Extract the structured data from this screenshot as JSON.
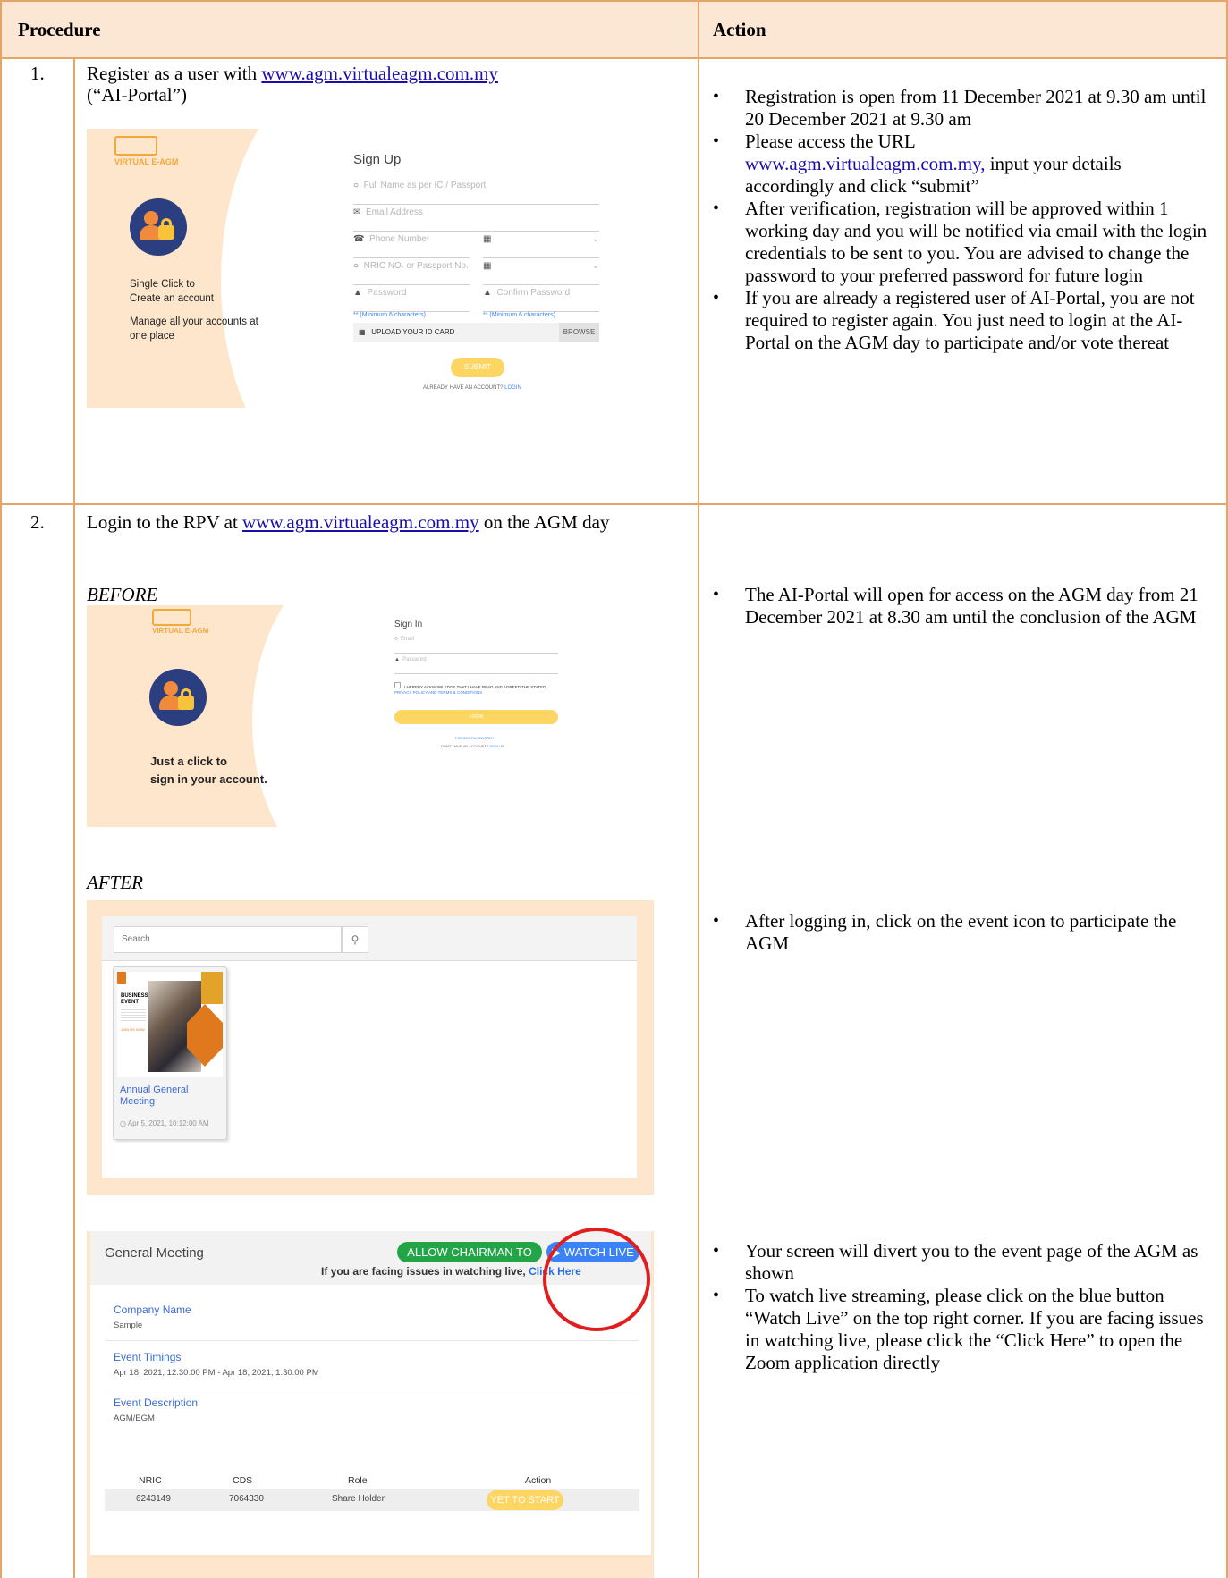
{
  "header": {
    "procedure": "Procedure",
    "action": "Action"
  },
  "rows": [
    {
      "number": "1.",
      "procedure_text_1": "Register as a user with ",
      "procedure_link": "www.agm.virtualeagm.com.my",
      "procedure_text_2": "(“AI-Portal”)",
      "signup": {
        "brand": "VIRTUAL E-AGM",
        "tagline_1": "Single Click to",
        "tagline_2": "Create an account",
        "tagline_3": "Manage all your accounts at",
        "tagline_4": "one place",
        "title": "Sign Up",
        "fullname_placeholder": "Full Name as per IC / Passport",
        "email_placeholder": "Email Address",
        "phone_placeholder": "Phone Number",
        "nric_placeholder": "NRIC NO. or Passport No.",
        "password_placeholder": "Password",
        "confirm_placeholder": "Confirm Password",
        "min_note": "** (Minimum 6 characters)",
        "upload_label": "UPLOAD YOUR ID CARD",
        "browse_label": "BROWSE",
        "submit_label": "SUBMIT",
        "already_text": "ALREADY HAVE AN ACCOUNT?",
        "login_link": "LOGIN"
      },
      "actions": [
        "Registration is open from 11 December 2021 at 9.30 am until 20 December 2021 at 9.30 am",
        "Please access the URL",
        "After verification, registration will be approved within 1 working day and you will be notified via email with the login credentials to be sent to you. You are advised to change the password to your preferred password for future login",
        "If you are already a registered user of AI-Portal, you are not required to register again. You just need to login at the AI-Portal on the AGM day to participate and/or vote thereat"
      ],
      "action_url": "www.agm.virtualeagm.com.my,",
      "action_url_tail": " input your details accordingly and click “submit”"
    },
    {
      "number": "2.",
      "procedure_text_1": "Login to the RPV at ",
      "procedure_link": "www.agm.virtualeagm.com.my",
      "procedure_text_2": " on the AGM day",
      "before_label": "BEFORE",
      "after_label": "AFTER",
      "signin": {
        "brand": "VIRTUAL E-AGM",
        "tagline_1": "Just a click to",
        "tagline_2": "sign in your account.",
        "title": "Sign In",
        "email_placeholder": "Email",
        "password_placeholder": "Password",
        "ack_text": "I HEREBY ACKNOWLEDGE THAT I HAVE READ AND AGREED THE STATED",
        "ack_link": "PRIVACY POLICY AND TERMS & CONDITIONS",
        "login_label": "LOGIN",
        "forgot": "FORGOT PASSWORD?",
        "no_account": "DON'T HAVE AN ACCOUNT?",
        "signup_link": "SIGN UP"
      },
      "portal": {
        "search_placeholder": "Search",
        "event_title": "Annual General Meeting",
        "event_date": "Apr 5, 2021, 10:12:00 AM",
        "poster_heading": "BUSINESS EVENT",
        "poster_join": "JOIN US NOW"
      },
      "event_page": {
        "title": "General Meeting",
        "vote_btn": "ALLOW CHAIRMAN TO VOTE",
        "watch_btn": "WATCH LIVE",
        "issue_text": "If you are facing issues in watching live, ",
        "issue_link": "Click Here",
        "company_label": "Company Name",
        "company_value": "Sample",
        "timings_label": "Event Timings",
        "timings_value": "Apr 18, 2021, 12:30:00 PM - Apr 18, 2021, 1:30:00 PM",
        "desc_label": "Event Description",
        "desc_value": "AGM/EGM",
        "table_headers": [
          "NRIC",
          "CDS",
          "Role",
          "Action"
        ],
        "table_row": [
          "6243149",
          "7064330",
          "Share Holder"
        ],
        "status_btn": "YET TO START"
      },
      "actions_a": [
        "The AI-Portal will open for access on the AGM day from 21 December 2021 at 8.30 am until the conclusion of the AGM"
      ],
      "actions_b": [
        "After logging in, click on the event icon to participate the AGM"
      ],
      "actions_c": [
        "Your screen will divert you to the event page of the AGM as shown",
        "To watch live streaming, please click on the blue button “Watch Live” on the top right corner. If you are facing issues in watching live, please click the “Click Here” to open the Zoom application directly"
      ]
    }
  ],
  "colors": {
    "border": "#e4a566",
    "header_bg": "#fce7d5",
    "panel_peach": "#fde6cb",
    "accent_yellow": "#fcd563",
    "live_blue": "#3b82f6",
    "vote_green": "#22a447",
    "highlight_red": "#e11d1d"
  }
}
